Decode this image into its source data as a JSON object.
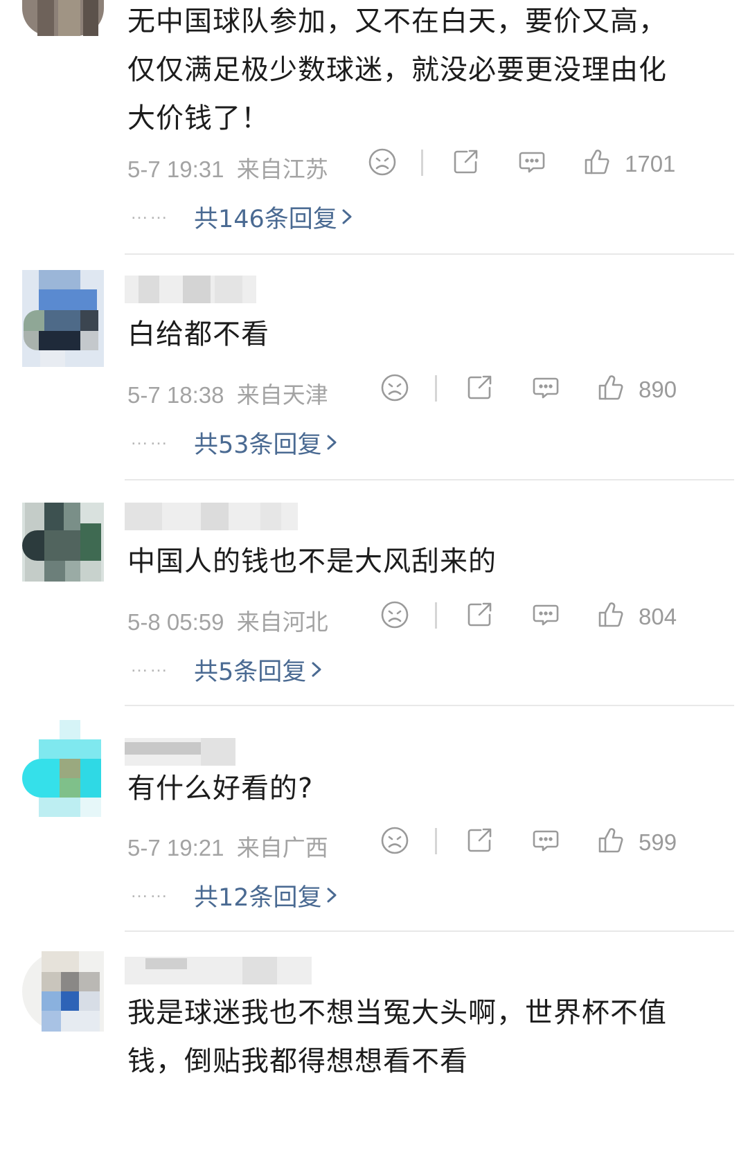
{
  "comments": [
    {
      "text": "无中国球队参加，又不在白天，要价又高，\n仅仅满足极少数球迷，就没必要更没理由化\n大价钱了！",
      "time": "5-7 19:31",
      "location": "来自江苏",
      "likes": "1701",
      "replies": "共146条回复"
    },
    {
      "text": "白给都不看",
      "time": "5-7 18:38",
      "location": "来自天津",
      "likes": "890",
      "replies": "共53条回复"
    },
    {
      "text": "中国人的钱也不是大风刮来的",
      "time": "5-8 05:59",
      "location": "来自河北",
      "likes": "804",
      "replies": "共5条回复"
    },
    {
      "text": "有什么好看的?",
      "time": "5-7 19:21",
      "location": "来自广西",
      "likes": "599",
      "replies": "共12条回复"
    },
    {
      "text": "我是球迷我也不想当冤大头啊，世界杯不值\n钱，倒贴我都得想想看不看"
    }
  ],
  "reply_dots": "……",
  "icons": {
    "dislike": "sad-face-icon",
    "share": "share-icon",
    "comment": "comment-icon",
    "like": "thumbs-up-icon",
    "chevron": "chevron-right-icon"
  },
  "colors": {
    "text": "#1c1c1c",
    "meta": "#a3a3a3",
    "link": "#4a6a92",
    "divider": "#e8e8e8"
  }
}
